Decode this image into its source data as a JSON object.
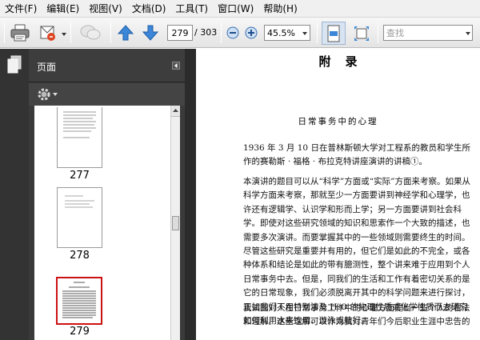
{
  "menu": {
    "items": [
      "文件(F)",
      "编辑(E)",
      "视图(V)",
      "文档(D)",
      "工具(T)",
      "窗口(W)",
      "帮助(H)"
    ]
  },
  "toolbar": {
    "current_page": "279",
    "total_pages": "/ 303",
    "zoom": "45.5%",
    "search_placeholder": "查找",
    "icons": [
      "print-icon",
      "email-icon",
      "comment-icon",
      "page-up-icon",
      "page-down-icon",
      "zoom-out-icon",
      "zoom-in-icon",
      "fit-page-icon",
      "full-screen-icon"
    ]
  },
  "sidebar": {
    "title": "页面",
    "options_icon": "gear-icon",
    "thumbnails": [
      {
        "label": "277",
        "selected": false
      },
      {
        "label": "278",
        "selected": false
      },
      {
        "label": "279",
        "selected": true
      }
    ]
  },
  "document": {
    "title": "附录",
    "heading": "日常事务中的心理",
    "intro": "1936 年 3 月 10 日在普林斯顿大学对工程系的教员和学生所作的赛勒斯 · 福格 · 布拉克特讲座演讲的讲稿①。",
    "paragraph1": "本演讲的题目可以从“科学”方面或“实际”方面来考察。如果从科学方面来考察，那就至少一方面要讲到神经学和心理学，也许还有逻辑学、认识学和形而上学；另一方面要讲到社会科学。即使对这些研究领域的知识和思索作一个大致的描述，也需要多次演讲。而要掌握其中的一些领域则需要终生的时间。尽管这些研究是重要并有用的，但它们是如此的不完全，或各种体系和结论是如此的带有臆测性，整个讲来难于应用到个人日常事务中去。但是，同我们的生活和工作有着密切关系的是它的日常现象，我们必须脱离开其中的科学问题来进行探讨，正如我们不用特别涉及 H₂O 的物理性质或化学性质而去研究如何利用水来饮用、游泳或航行。",
    "paragraph2": "我试图对人在日常事务工作中的心理方面提出一些个人的看法和理解。这些理解可以作为我对青年们今后职业生涯中忠告的"
  }
}
